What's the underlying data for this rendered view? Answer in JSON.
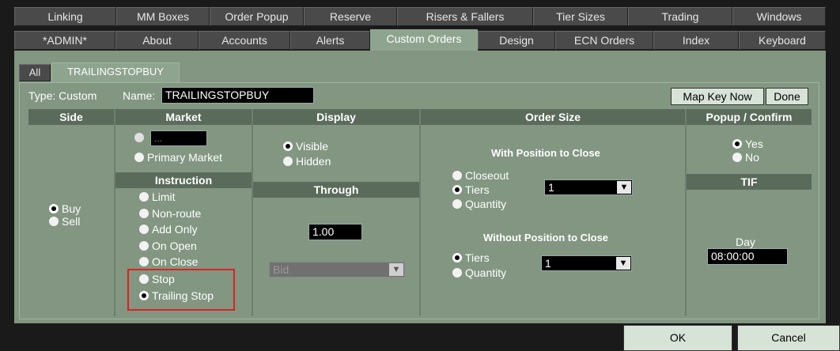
{
  "tabs_row1": [
    "Linking",
    "MM Boxes",
    "Order Popup",
    "Reserve",
    "Risers & Fallers",
    "Tier Sizes",
    "Trading",
    "Windows"
  ],
  "tabs_row2": [
    "*ADMIN*",
    "About",
    "Accounts",
    "Alerts",
    "Custom Orders",
    "Design",
    "ECN Orders",
    "Index",
    "Keyboard"
  ],
  "subtabs": [
    "All",
    "TRAILINGSTOPBUY"
  ],
  "type_label": "Type: Custom",
  "name_label": "Name:",
  "name_value": "TRAILINGSTOPBUY",
  "map_key_label": "Map Key Now",
  "done_label": "Done",
  "headers": {
    "side": "Side",
    "market": "Market",
    "display": "Display",
    "order_size": "Order Size",
    "popup": "Popup / Confirm",
    "instruction": "Instruction",
    "through": "Through",
    "tif": "TIF"
  },
  "side": {
    "buy": "Buy",
    "sell": "Sell"
  },
  "market": {
    "field_value": "...",
    "primary": "Primary Market"
  },
  "instruction": [
    "Limit",
    "Non-route",
    "Add Only",
    "On Open",
    "On Close",
    "Stop",
    "Trailing Stop"
  ],
  "display": {
    "visible": "Visible",
    "hidden": "Hidden"
  },
  "through": {
    "value": "1.00",
    "select": "Bid"
  },
  "order_size": {
    "with_title": "With Position to Close",
    "closeout": "Closeout",
    "tiers": "Tiers",
    "quantity": "Quantity",
    "with_tier_value": "1",
    "without_title": "Without Position to Close",
    "without_tier_value": "1"
  },
  "popup": {
    "yes": "Yes",
    "no": "No"
  },
  "tif": {
    "day": "Day",
    "time": "08:00:00"
  },
  "footer": {
    "ok": "OK",
    "cancel": "Cancel"
  },
  "colors": {
    "panel": "#829682",
    "header": "#5b6b5b",
    "active_tab": "#8fa48f",
    "highlight": "#e02020"
  }
}
